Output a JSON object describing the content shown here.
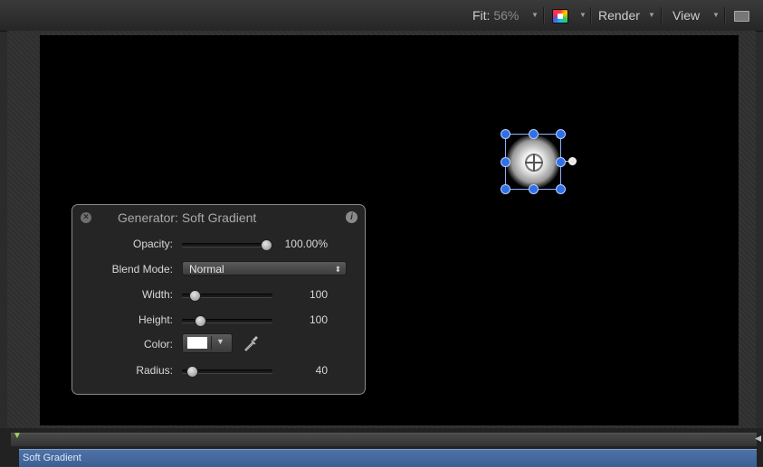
{
  "toolbar": {
    "fit_label": "Fit:",
    "fit_value": "56%",
    "render_label": "Render",
    "view_label": "View",
    "color_icon": "color-channels-icon",
    "layout_icon": "view-layout-icon"
  },
  "hud": {
    "title": "Generator: Soft Gradient",
    "opacity": {
      "label": "Opacity:",
      "value": "100.00%",
      "fraction": 1.0
    },
    "blend_mode": {
      "label": "Blend Mode:",
      "value": "Normal"
    },
    "width": {
      "label": "Width:",
      "value": "100"
    },
    "height": {
      "label": "Height:",
      "value": "100"
    },
    "color": {
      "label": "Color:",
      "value_hex": "#ffffff"
    },
    "radius": {
      "label": "Radius:",
      "value": "40"
    }
  },
  "timeline": {
    "clip_label": "Soft Gradient"
  },
  "colors": {
    "accent_blue": "#2f6fe8",
    "clip_bar": "#4a6ea3",
    "playhead": "#9fd65a"
  }
}
